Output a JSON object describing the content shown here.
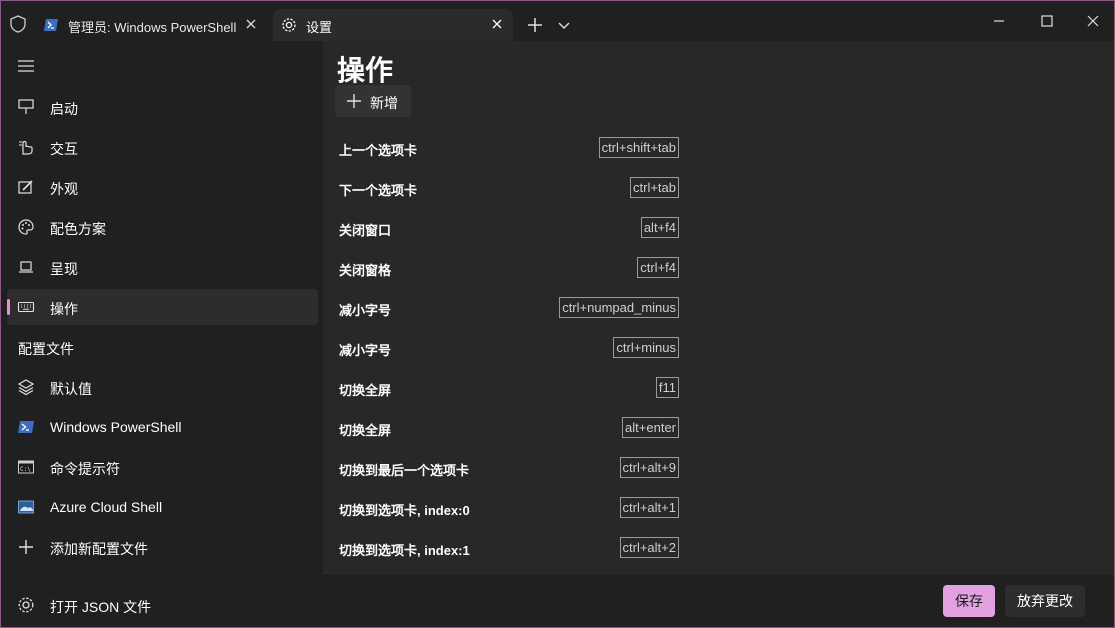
{
  "titlebar": {
    "tabs": [
      {
        "label": "管理员: Windows PowerShell",
        "icon": "powershell-icon"
      },
      {
        "label": "设置",
        "icon": "gear-icon"
      }
    ]
  },
  "sidebar": {
    "items": [
      {
        "label": "启动",
        "icon": "startup-icon"
      },
      {
        "label": "交互",
        "icon": "interaction-icon"
      },
      {
        "label": "外观",
        "icon": "appearance-icon"
      },
      {
        "label": "配色方案",
        "icon": "palette-icon"
      },
      {
        "label": "呈现",
        "icon": "rendering-icon"
      },
      {
        "label": "操作",
        "icon": "keyboard-icon",
        "selected": true
      }
    ],
    "profiles_header": "配置文件",
    "profiles": [
      {
        "label": "默认值",
        "icon": "layers-icon"
      },
      {
        "label": "Windows PowerShell",
        "icon": "powershell-icon"
      },
      {
        "label": "命令提示符",
        "icon": "cmd-icon"
      },
      {
        "label": "Azure Cloud Shell",
        "icon": "azure-icon"
      },
      {
        "label": "添加新配置文件",
        "icon": "plus-icon"
      }
    ],
    "open_json": "打开 JSON 文件"
  },
  "main": {
    "title": "操作",
    "add_label": "新增",
    "actions": [
      {
        "name": "上一个选项卡",
        "keys": "ctrl+shift+tab"
      },
      {
        "name": "下一个选项卡",
        "keys": "ctrl+tab"
      },
      {
        "name": "关闭窗口",
        "keys": "alt+f4"
      },
      {
        "name": "关闭窗格",
        "keys": "ctrl+f4"
      },
      {
        "name": "减小字号",
        "keys": "ctrl+numpad_minus"
      },
      {
        "name": "减小字号",
        "keys": "ctrl+minus"
      },
      {
        "name": "切换全屏",
        "keys": "f11"
      },
      {
        "name": "切换全屏",
        "keys": "alt+enter"
      },
      {
        "name": "切换到最后一个选项卡",
        "keys": "ctrl+alt+9"
      },
      {
        "name": "切换到选项卡, index:0",
        "keys": "ctrl+alt+1"
      },
      {
        "name": "切换到选项卡, index:1",
        "keys": "ctrl+alt+2"
      }
    ]
  },
  "footer": {
    "save": "保存",
    "discard": "放弃更改"
  },
  "colors": {
    "accent": "#e3a1e1",
    "background": "#202020",
    "content_background": "#282828"
  }
}
